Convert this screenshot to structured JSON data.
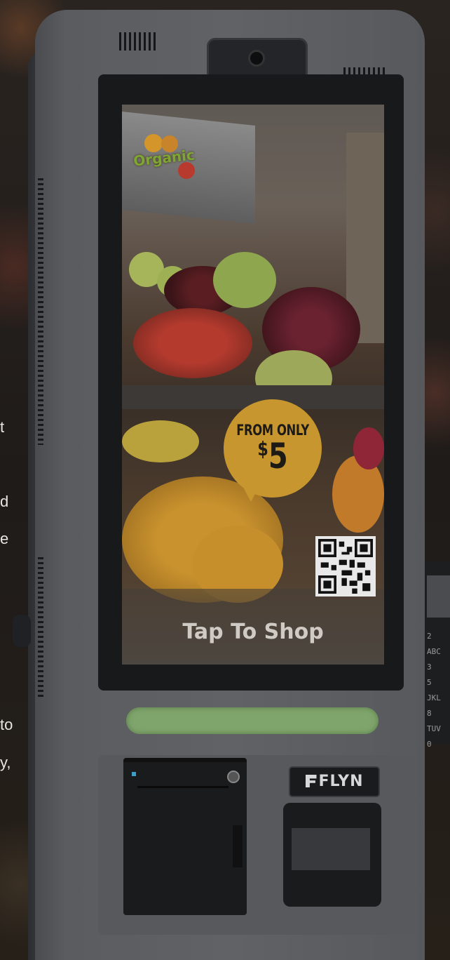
{
  "background": {
    "edge_text_lines": [
      "t",
      "d",
      "e",
      "to",
      "y,"
    ]
  },
  "kiosk": {
    "screen": {
      "badge": "Organic",
      "promo_line1": "FROM ONLY",
      "promo_currency": "$",
      "promo_amount": "5",
      "cta": "Tap To Shop"
    },
    "brand_logo": "FLYN",
    "terminal_keys": [
      "2 ABC 3",
      "5 JKL",
      "8 TUV",
      "0"
    ]
  },
  "colors": {
    "promo_bubble": "#c8962e",
    "scan_bar": "#7fa46c",
    "kiosk_body": "#5e6064"
  }
}
